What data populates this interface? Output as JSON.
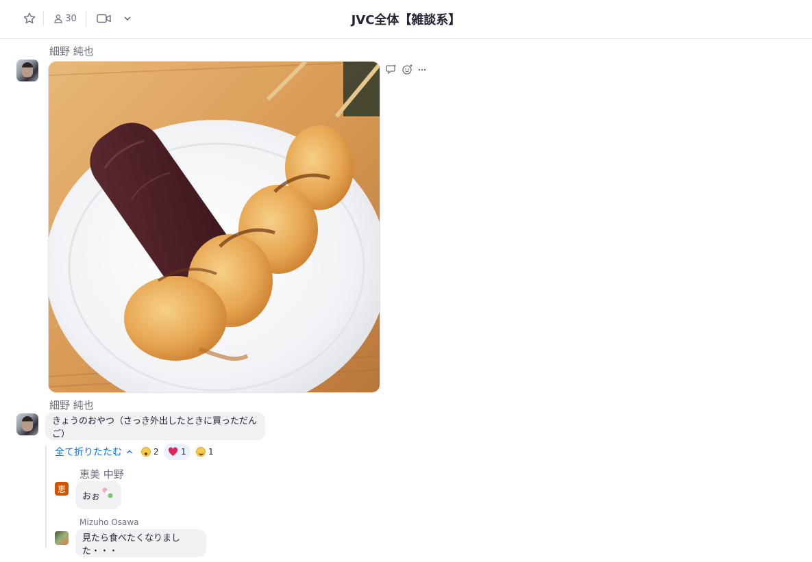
{
  "header": {
    "channel_title": "JVC全体【雑談系】",
    "member_count": "30",
    "icons": [
      "star-icon",
      "person-icon",
      "video-icon",
      "chevron-down-icon"
    ]
  },
  "messages": [
    {
      "sender": "細野 純也",
      "type": "image",
      "image_desc": "dango"
    },
    {
      "sender": "細野 純也",
      "text": "きょうのおやつ（さっき外出したときに買っただんご）"
    }
  ],
  "thread": {
    "collapse_label": "全て折りたたむ",
    "reactions": [
      {
        "emoji": "shocked-face",
        "count": "2"
      },
      {
        "emoji": "red-heart",
        "count": "1"
      },
      {
        "emoji": "smiling-face",
        "count": "1"
      }
    ],
    "replies": [
      {
        "sender": "恵美 中野",
        "avatar_letter": "恵",
        "text": "おぉ"
      },
      {
        "sender": "Mizuho Osawa",
        "text": "見たら食べたくなりました・・・"
      }
    ]
  },
  "colors": {
    "accent": "#0e72ed",
    "bubble": "#f1f1f4",
    "avatar_orange": "#d35400",
    "heart": "#e0245e"
  }
}
